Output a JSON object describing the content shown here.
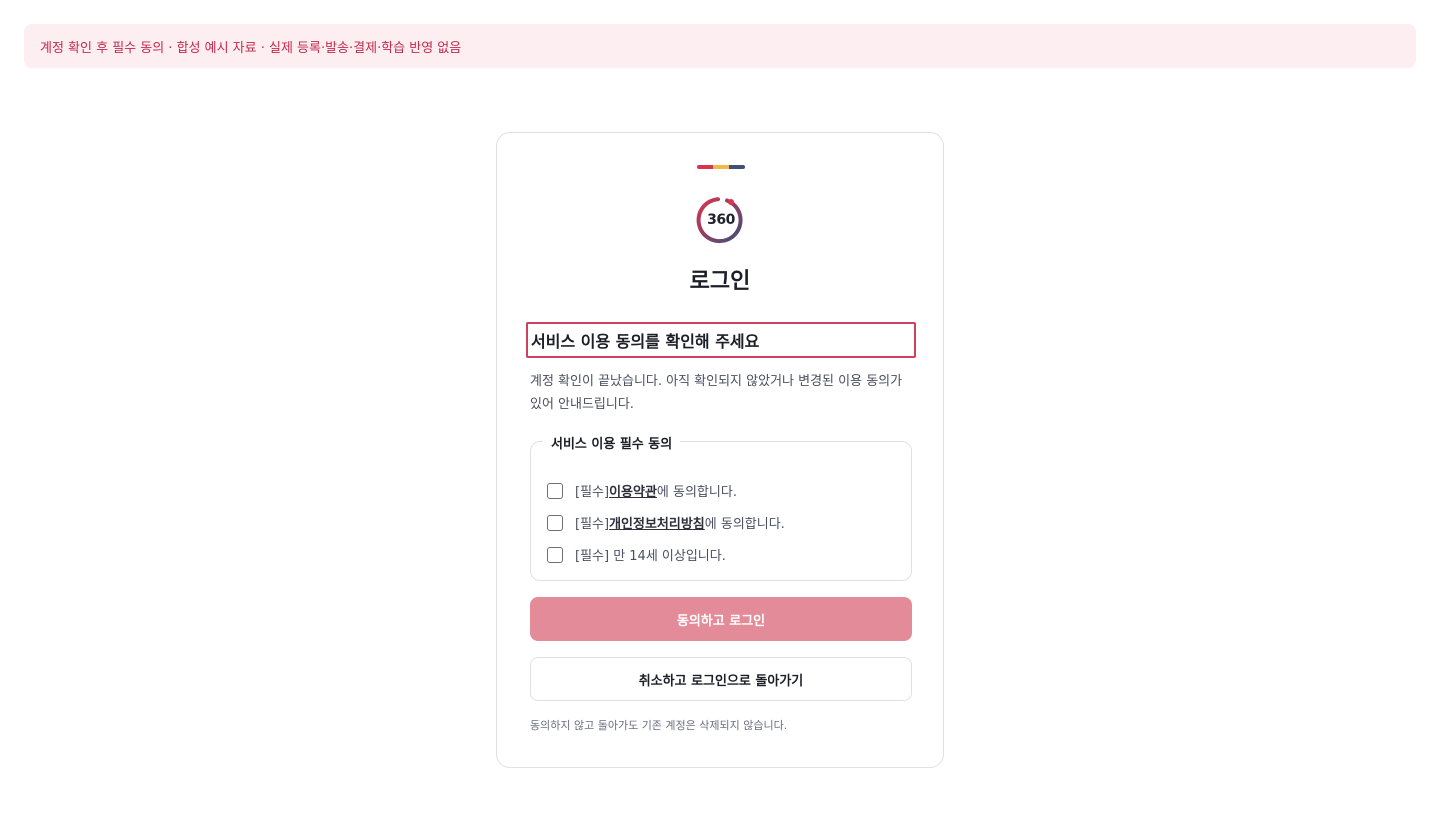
{
  "banner": {
    "text": "계정 확인 후 필수 동의 · 합성 예시 자료 · 실제 등록·발송·결제·학습 반영 없음"
  },
  "brand": {
    "logo_text": "360",
    "colors": [
      "#d8344f",
      "#f2b84b",
      "#3f4f7a"
    ]
  },
  "page": {
    "title": "로그인"
  },
  "consent": {
    "heading": "서비스 이용 동의를 확인해 주세요",
    "description": "계정 확인이 끝났습니다. 아직 확인되지 않았거나 변경된 이용 동의가 있어 안내드립니다.",
    "group_legend": "서비스 이용 필수 동의",
    "items": [
      {
        "prefix": "[필수] ",
        "link": "이용약관",
        "suffix": "에 동의합니다.",
        "checked": false
      },
      {
        "prefix": "[필수] ",
        "link": "개인정보처리방침",
        "suffix": "에 동의합니다.",
        "checked": false
      },
      {
        "prefix": "[필수] 만 14세 이상입니다.",
        "link": "",
        "suffix": "",
        "checked": false
      }
    ],
    "agree_button": "동의하고 로그인",
    "cancel_button": "취소하고 로그인으로 돌아가기",
    "footnote": "동의하지 않고 돌아가도 기존 계정은 삭제되지 않습니다."
  },
  "colors": {
    "accent": "#d0405f",
    "button_disabled": "#e48b9a",
    "banner_bg": "#fdeef1",
    "banner_text": "#c42a4d"
  }
}
